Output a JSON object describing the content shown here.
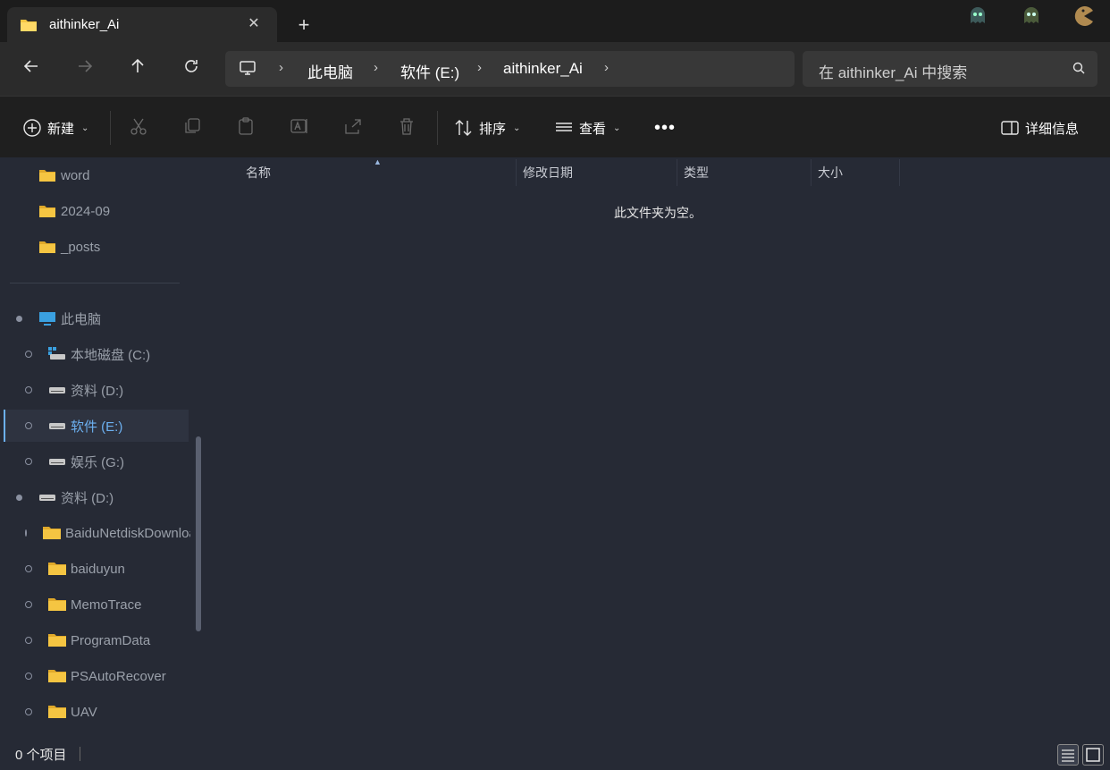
{
  "tab": {
    "title": "aithinker_Ai"
  },
  "breadcrumb": [
    "此电脑",
    "软件 (E:)",
    "aithinker_Ai"
  ],
  "search": {
    "placeholder": "在 aithinker_Ai 中搜索"
  },
  "toolbar": {
    "new_label": "新建",
    "sort_label": "排序",
    "view_label": "查看",
    "details_label": "详细信息"
  },
  "sidebar": {
    "items": [
      {
        "label": "word"
      },
      {
        "label": "2024-09"
      },
      {
        "label": "_posts"
      },
      {
        "label": "此电脑"
      },
      {
        "label": "本地磁盘 (C:)"
      },
      {
        "label": "资料 (D:)"
      },
      {
        "label": "软件 (E:)"
      },
      {
        "label": "娱乐 (G:)"
      },
      {
        "label": "资料 (D:)"
      },
      {
        "label": "BaiduNetdiskDownload"
      },
      {
        "label": "baiduyun"
      },
      {
        "label": "MemoTrace"
      },
      {
        "label": "ProgramData"
      },
      {
        "label": "PSAutoRecover"
      },
      {
        "label": "UAV"
      }
    ]
  },
  "columns": [
    "名称",
    "修改日期",
    "类型",
    "大小"
  ],
  "empty_message": "此文件夹为空。",
  "status": {
    "count_text": "0 个项目"
  },
  "colors": {
    "accent": "#6cb0f0",
    "folder": "#f5c542",
    "background": "#262a35"
  }
}
